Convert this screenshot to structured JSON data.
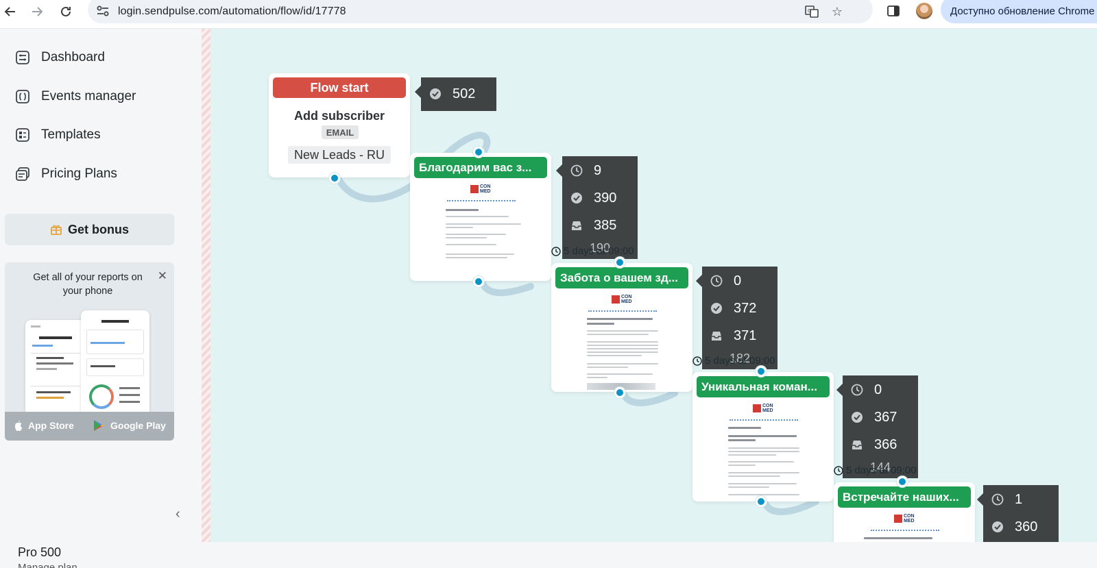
{
  "browser": {
    "url": "login.sendpulse.com/automation/flow/id/17778",
    "update_label": "Доступно обновление Chrome"
  },
  "sidebar": {
    "items": [
      {
        "label": "Dashboard",
        "icon": "dashboard-icon"
      },
      {
        "label": "Events manager",
        "icon": "events-icon"
      },
      {
        "label": "Templates",
        "icon": "templates-icon"
      },
      {
        "label": "Pricing Plans",
        "icon": "pricing-icon"
      }
    ],
    "bonus_label": "Get bonus",
    "promo": {
      "text": "Get all of your reports on your phone",
      "app_store_label": "App Store",
      "google_play_label": "Google Play"
    },
    "plan_name": "Pro 500",
    "plan_link": "Manage plan"
  },
  "flow": {
    "start": {
      "header": "Flow start",
      "action": "Add subscriber",
      "channel": "EMAIL",
      "list": "New Leads - RU",
      "stats": {
        "done": "502"
      }
    },
    "emails": [
      {
        "title": "Благодарим вас з...",
        "stats": {
          "waiting": "9",
          "done": "390",
          "inbox": "385"
        },
        "delay": null
      },
      {
        "title": "Забота о вашем зд...",
        "stats": {
          "waiting": "0",
          "done": "372",
          "inbox": "371"
        },
        "delay": "5 days at 09:00"
      },
      {
        "title": "Уникальная коман...",
        "stats": {
          "waiting": "0",
          "done": "367",
          "inbox": "366"
        },
        "delay": "5 days at 09:00"
      },
      {
        "title": "Встречайте наших...",
        "stats": {
          "waiting": "1",
          "done": "360"
        },
        "delay": "5 days at 09:00"
      }
    ],
    "hidden_counts": [
      "190",
      "182",
      "144"
    ]
  },
  "colors": {
    "flow_start": "#d64f45",
    "email_header": "#1e9e52",
    "port": "#0a93c4",
    "stats_bg": "#3f4344",
    "canvas_bg": "#e2f3f3"
  }
}
